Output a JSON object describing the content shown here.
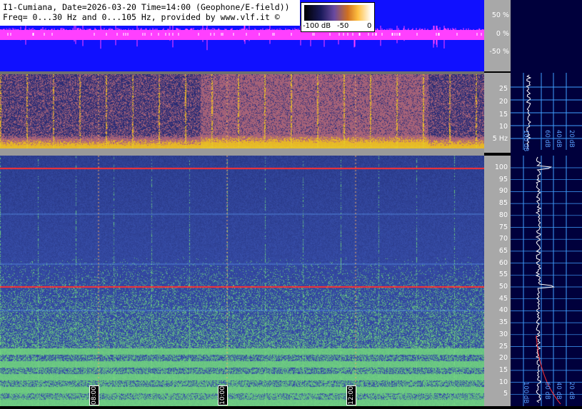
{
  "header": {
    "line1": "I1-Cumiana, Date=2026-03-20 Time=14:00 (Geophone/E-field))",
    "line2": "Freq= 0...30 Hz and 0...105 Hz, provided by www.vlf.it ©"
  },
  "legend": {
    "labels": [
      "-100 dB",
      "-50",
      "0"
    ]
  },
  "percent_scale": [
    "50 %",
    "0 %",
    "-50 %"
  ],
  "spec1_ticks": [
    "25",
    "20",
    "15",
    "10",
    "5 Hz"
  ],
  "spec2_ticks": [
    "100",
    "95",
    "90",
    "85",
    "80",
    "75",
    "70",
    "65",
    "60",
    "55",
    "50",
    "45",
    "40",
    "35",
    "30",
    "25",
    "20",
    "15",
    "10",
    "5"
  ],
  "time_labels": [
    "08:00",
    "10:00",
    "12:00"
  ],
  "panel_labels_top": [
    "100 dB",
    "60 dB",
    "40 dB",
    "20 dB"
  ],
  "panel_labels_bottom": [
    "100 dB",
    "60 dB",
    "40 dB",
    "20 dB"
  ],
  "colors": {
    "header_bg": "#1010ff",
    "wave": "#ff40ff",
    "scale_bg": "#a8a8a8",
    "panel_bg": "#00003c",
    "grid": "#40a0ff",
    "mains_line": "#ff3030"
  }
}
